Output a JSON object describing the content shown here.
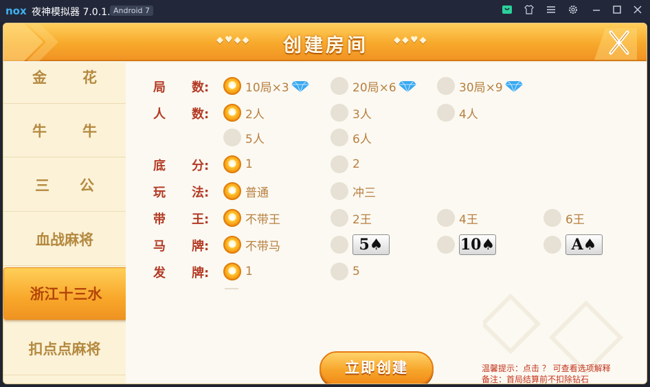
{
  "window": {
    "logo": "nox",
    "title": "夜神模拟器 7.0.1.0",
    "badge": "Android 7",
    "icons": [
      "store-icon",
      "shirt-icon",
      "menu-icon",
      "gear-icon",
      "minimize-icon",
      "maximize-icon",
      "close-icon"
    ]
  },
  "header": {
    "title": "创建房间",
    "suits_left": "◆♥◆◆",
    "suits_right": "◆◆♥◆"
  },
  "sidebar": {
    "items": [
      {
        "label": "金花"
      },
      {
        "label": "牛牛"
      },
      {
        "label": "三公"
      },
      {
        "label": "血战麻将"
      },
      {
        "label": "浙江十三水",
        "active": true
      },
      {
        "label": "扣点点麻将"
      }
    ]
  },
  "rows": {
    "rounds": {
      "label1": "局",
      "label2": "数:",
      "options": [
        {
          "label": "10局×3",
          "selected": true
        },
        {
          "label": "20局×6",
          "selected": false
        },
        {
          "label": "30局×9",
          "selected": false
        }
      ]
    },
    "players": {
      "label1": "人",
      "label2": "数:",
      "options": [
        {
          "label": "2人",
          "selected": true
        },
        {
          "label": "3人",
          "selected": false
        },
        {
          "label": "4人",
          "selected": false
        },
        {
          "label": "5人",
          "selected": false
        },
        {
          "label": "6人",
          "selected": false
        }
      ]
    },
    "base": {
      "label1": "底",
      "label2": "分:",
      "options": [
        {
          "label": "1",
          "selected": true
        },
        {
          "label": "2",
          "selected": false
        }
      ]
    },
    "mode": {
      "label1": "玩",
      "label2": "法:",
      "options": [
        {
          "label": "普通",
          "selected": true
        },
        {
          "label": "冲三",
          "selected": false
        }
      ]
    },
    "kings": {
      "label1": "带",
      "label2": "王:",
      "options": [
        {
          "label": "不带王",
          "selected": true
        },
        {
          "label": "2王",
          "selected": false
        },
        {
          "label": "4王",
          "selected": false
        },
        {
          "label": "6王",
          "selected": false
        }
      ]
    },
    "horse": {
      "label1": "马",
      "label2": "牌:",
      "options": [
        {
          "label": "不带马",
          "selected": true
        },
        {
          "label": "5♠",
          "selected": false
        },
        {
          "label": "10♠",
          "selected": false
        },
        {
          "label": "A♠",
          "selected": false
        }
      ]
    },
    "deal": {
      "label1": "发",
      "label2": "牌:",
      "options": [
        {
          "label": "1",
          "selected": true
        },
        {
          "label": "5",
          "selected": false
        }
      ]
    }
  },
  "create_button": "立即创建",
  "tips": {
    "line1": "温馨提示：点击 ？ 可查看选项解释",
    "line2": "备注：首局结算前不扣除钻石"
  },
  "colors": {
    "accent": "#f7a92b",
    "label": "#b33a24",
    "option_text": "#b87f3f"
  }
}
